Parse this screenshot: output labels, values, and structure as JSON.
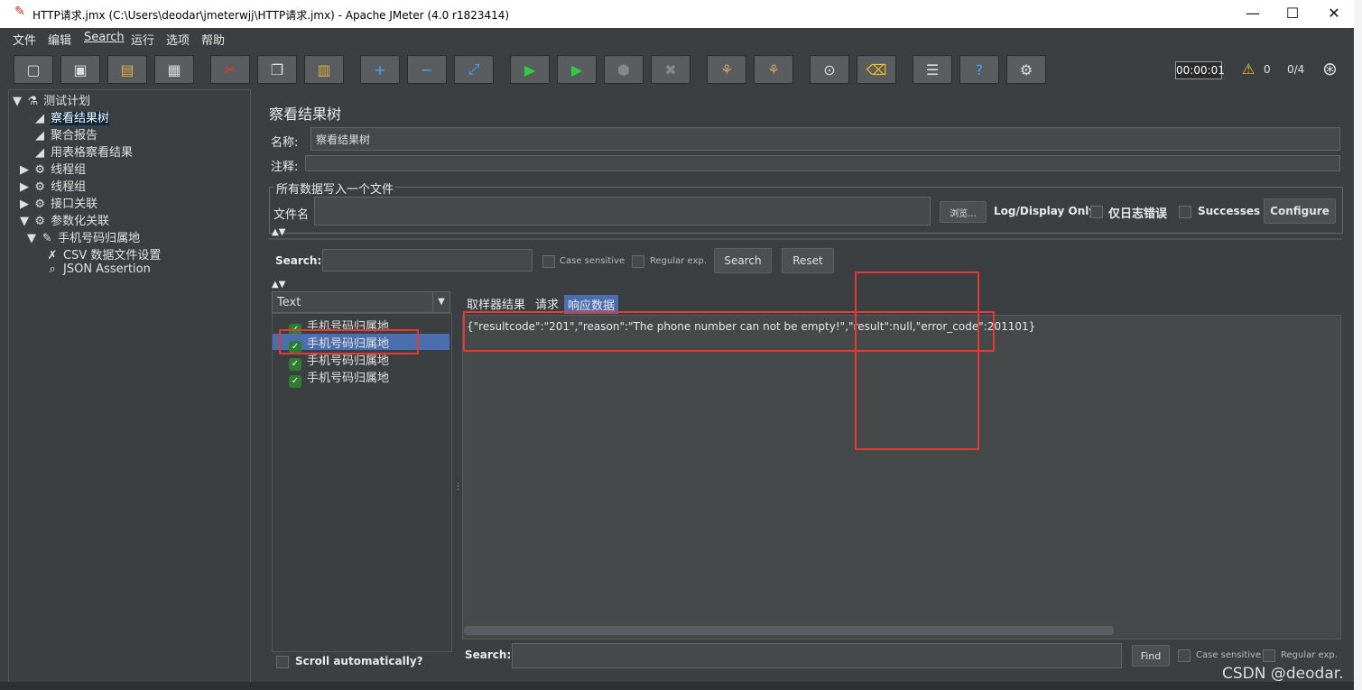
{
  "window": {
    "title": "HTTP请求.jmx (C:\\Users\\deodar\\jmeterwjj\\HTTP请求.jmx) - Apache JMeter (4.0 r1823414)"
  },
  "menu": [
    "文件",
    "编辑",
    "Search",
    "运行",
    "选项",
    "帮助"
  ],
  "toolbar": {
    "icons": [
      "new-icon",
      "templates-icon",
      "open-icon",
      "save-icon",
      "cut-icon",
      "copy-icon",
      "paste-icon",
      "expand-icon",
      "collapse-icon",
      "toggle-icon",
      "start-icon",
      "start-no-pause-icon",
      "stop-icon",
      "shutdown-icon",
      "clear-icon",
      "clear-all-icon",
      "search-icon",
      "reset-search-icon",
      "function-helper-icon",
      "help-icon",
      "remote-icon"
    ],
    "timer": "00:00:01",
    "warnings": "0",
    "threads": "0/4"
  },
  "tree": {
    "items": [
      {
        "label": "测试计划",
        "icon": "test-plan-icon"
      },
      {
        "label": "察看结果树",
        "icon": "listener-icon"
      },
      {
        "label": "聚合报告",
        "icon": "listener-icon"
      },
      {
        "label": "用表格察看结果",
        "icon": "listener-icon"
      },
      {
        "label": "线程组",
        "icon": "gear-icon"
      },
      {
        "label": "线程组",
        "icon": "gear-icon"
      },
      {
        "label": "接口关联",
        "icon": "gear-icon"
      },
      {
        "label": "参数化关联",
        "icon": "gear-icon"
      },
      {
        "label": "手机号码归属地",
        "icon": "sampler-icon"
      },
      {
        "label": "CSV 数据文件设置",
        "icon": "config-icon"
      },
      {
        "label": "JSON Assertion",
        "icon": "assertion-icon"
      }
    ]
  },
  "panel": {
    "title": "察看结果树",
    "name_label": "名称:",
    "name_value": "察看结果树",
    "comment_label": "注释:",
    "fieldset_label": "所有数据写入一个文件",
    "filename_label": "文件名",
    "browse_label": "浏览...",
    "log_only_label": "Log/Display Only:",
    "errors_label": "仅日志错误",
    "successes_label": "Successes",
    "configure_label": "Configure",
    "search_label": "Search:",
    "case_label": "Case sensitive",
    "regex_label": "Regular exp.",
    "search_button": "Search",
    "reset_button": "Reset",
    "renderer": "Text",
    "results": [
      "手机号码归属地",
      "手机号码归属地",
      "手机号码归属地",
      "手机号码归属地"
    ],
    "tabs": [
      "取样器结果",
      "请求",
      "响应数据"
    ],
    "response": "{\"resultcode\":\"201\",\"reason\":\"The phone number can not be empty!\",\"result\":null,\"error_code\":201101}",
    "scroll_label": "Scroll automatically?",
    "bottom_search_label": "Search:",
    "find_button": "Find",
    "bottom_case_label": "Case sensitive",
    "bottom_regex_label": "Regular exp."
  },
  "watermark": "CSDN @deodar.",
  "colors": {
    "background": "#3c3f41",
    "selection": "#0d293e",
    "annotation": "#e53935",
    "tab_active": "#4b6eaf"
  }
}
